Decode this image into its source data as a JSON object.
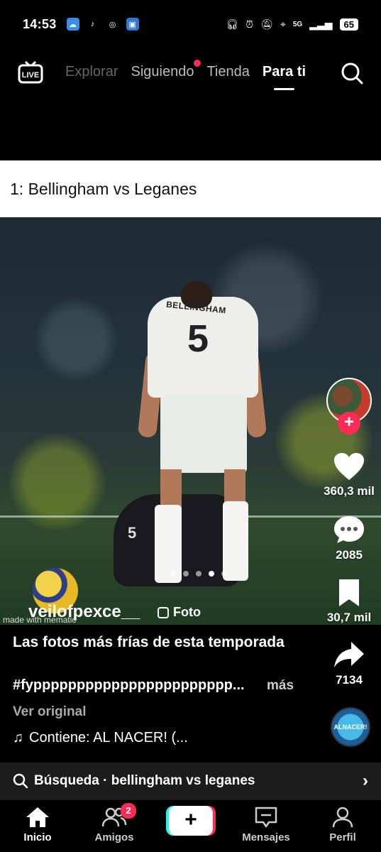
{
  "status_bar": {
    "time": "14:53",
    "signal": "5G",
    "battery": "65"
  },
  "top_nav": {
    "tabs": [
      "Explorar",
      "Siguiendo",
      "Tienda",
      "Para ti"
    ],
    "active_tab": "Para ti"
  },
  "banner": {
    "text": "1: Bellingham vs Leganes"
  },
  "post": {
    "username": "veilofpexce__",
    "type_label": "Foto",
    "watermark": "made with mematic",
    "shirt_name": "BELLINGHAM",
    "shirt_number": "5",
    "caption": "Las fotos más frías de esta temporada",
    "hashtags": "#fyppppppppppppppppppppppp...",
    "more_label": "más",
    "view_original": "Ver original",
    "sound": "Contiene: AL NACER! (...",
    "sound_disc_text": "ALNACER!",
    "carousel": {
      "count": 5,
      "active_index": 3
    }
  },
  "actions": {
    "likes": "360,3 mil",
    "comments": "2085",
    "saves": "30,7 mil",
    "shares": "7134"
  },
  "search_suggestion": {
    "text": "Búsqueda · bellingham vs leganes"
  },
  "tab_bar": {
    "home": "Inicio",
    "friends": "Amigos",
    "friends_badge": "2",
    "create": "+",
    "inbox": "Mensajes",
    "profile": "Perfil"
  },
  "colors": {
    "accent": "#fe2c55",
    "cyan": "#25f4ee",
    "background": "#000000"
  }
}
